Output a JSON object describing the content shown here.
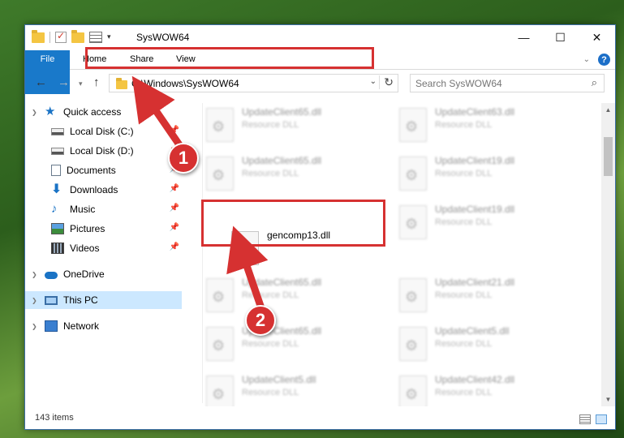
{
  "window": {
    "title": "SysWOW64"
  },
  "ribbon": {
    "tabs": [
      "File",
      "Home",
      "Share",
      "View"
    ]
  },
  "address": {
    "path": "C:\\Windows\\SysWOW64"
  },
  "search": {
    "placeholder": "Search SysWOW64"
  },
  "sidebar": {
    "items": [
      {
        "label": "Quick access",
        "icon": "star-icon"
      },
      {
        "label": "Local Disk (C:)",
        "icon": "disk-icon"
      },
      {
        "label": "Local Disk (D:)",
        "icon": "disk-icon"
      },
      {
        "label": "Documents",
        "icon": "documents-icon"
      },
      {
        "label": "Downloads",
        "icon": "downloads-icon"
      },
      {
        "label": "Music",
        "icon": "music-icon"
      },
      {
        "label": "Pictures",
        "icon": "pictures-icon"
      },
      {
        "label": "Videos",
        "icon": "videos-icon"
      },
      {
        "label": "OneDrive",
        "icon": "onedrive-icon"
      },
      {
        "label": "This PC",
        "icon": "this-pc-icon"
      },
      {
        "label": "Network",
        "icon": "network-icon"
      }
    ]
  },
  "files": {
    "left": [
      {
        "name": "UpdateClient65.dll",
        "type": "Resource DLL"
      },
      {
        "name": "UpdateClient65.dll",
        "type": "Resource DLL"
      },
      {
        "name": "gencomp13.dll",
        "type": ""
      },
      {
        "name": "UpdateClient65.dll",
        "type": "Resource DLL"
      },
      {
        "name": "UpdateClient65.dll",
        "type": "Resource DLL"
      },
      {
        "name": "UpdateClient5.dll",
        "type": "Resource DLL"
      }
    ],
    "right": [
      {
        "name": "UpdateClient63.dll",
        "type": "Resource DLL"
      },
      {
        "name": "UpdateClient19.dll",
        "type": "Resource DLL"
      },
      {
        "name": "UpdateClient19.dll",
        "type": "Resource DLL"
      },
      {
        "name": "UpdateClient21.dll",
        "type": "Resource DLL"
      },
      {
        "name": "UpdateClient5.dll",
        "type": "Resource DLL"
      },
      {
        "name": "UpdateClient42.dll",
        "type": "Resource DLL"
      }
    ]
  },
  "status": {
    "count": "143 items"
  },
  "callouts": {
    "one": "1",
    "two": "2"
  },
  "colors": {
    "accent": "#1979ca",
    "highlight": "#d63131"
  }
}
